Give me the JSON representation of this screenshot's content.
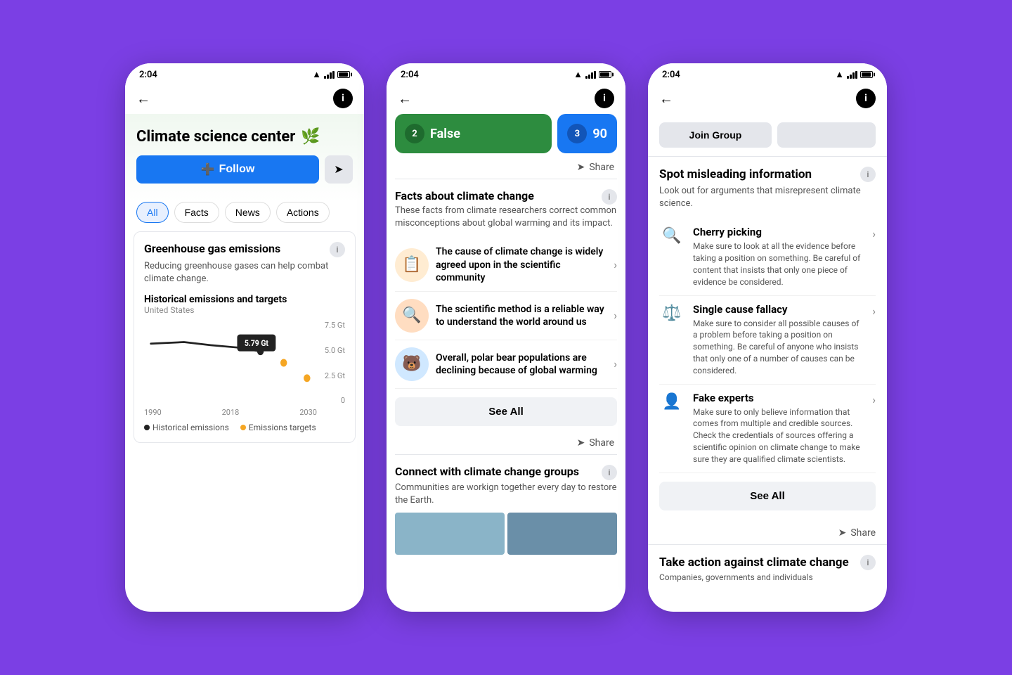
{
  "background": "#7b3fe4",
  "phones": [
    {
      "id": "phone1",
      "status_time": "2:04",
      "header_title": "Climate science center",
      "header_emoji": "🌿",
      "follow_label": "Follow",
      "tabs": [
        "All",
        "Facts",
        "News",
        "Actions"
      ],
      "active_tab": "All",
      "section_title": "Greenhouse gas emissions",
      "section_desc": "Reducing greenhouse gases can help combat climate change.",
      "chart_title": "Historical emissions and targets",
      "chart_subtitle": "United States",
      "chart_tooltip": "5.79 Gt",
      "y_labels": [
        "7.5 Gt",
        "5.0 Gt",
        "2.5 Gt",
        "0"
      ],
      "x_labels": [
        "1990",
        "2018",
        "2030"
      ],
      "legend": [
        {
          "label": "Historical emissions",
          "color": "#222"
        },
        {
          "label": "Emissions targets",
          "color": "#f5a623"
        }
      ]
    },
    {
      "id": "phone2",
      "status_time": "2:04",
      "top_cards": [
        {
          "badge": "2",
          "label": "False",
          "bg": "#2d8c3f"
        },
        {
          "badge": "3",
          "label": "90",
          "bg": "#1877f2"
        }
      ],
      "share_label": "Share",
      "facts_title": "Facts about climate change",
      "facts_desc": "These facts from climate researchers correct common misconceptions about global warming and its impact.",
      "fact_items": [
        {
          "icon": "📋",
          "icon_bg": "#ffecd2",
          "text": "The cause of climate change is widely agreed upon in the scientific community"
        },
        {
          "icon": "🔍",
          "icon_bg": "#ffddc1",
          "text": "The scientific method is a reliable way to understand the world around us"
        },
        {
          "icon": "🐻‍❄️",
          "icon_bg": "#d0e8ff",
          "text": "Overall, polar bear populations are declining because of global warming"
        }
      ],
      "see_all_label": "See All",
      "connect_title": "Connect with climate change groups",
      "connect_desc": "Communities are workign together every day to restore the Earth."
    },
    {
      "id": "phone3",
      "status_time": "2:04",
      "join_group_label": "Join Group",
      "spot_title": "Spot misleading information",
      "spot_desc": "Look out for arguments that misrepresent climate science.",
      "mislead_items": [
        {
          "icon": "🔍",
          "title": "Cherry picking",
          "desc": "Make sure to look at all the evidence before taking a position on something. Be careful of content that insists that only one piece of evidence be considered."
        },
        {
          "icon": "⚖️",
          "title": "Single cause fallacy",
          "desc": "Make sure to consider all possible causes of a problem before taking a position on something. Be careful of anyone who insists that only one of a number of causes can be considered."
        },
        {
          "icon": "👤",
          "title": "Fake experts",
          "desc": "Make sure to only believe information that comes from multiple and credible sources. Check the credentials of sources offering a scientific opinion on climate change to make sure they are qualified climate scientists."
        }
      ],
      "see_all_label": "See All",
      "share_label": "Share",
      "take_action_title": "Take action against climate change",
      "take_action_desc": "Companies, governments and individuals"
    }
  ]
}
